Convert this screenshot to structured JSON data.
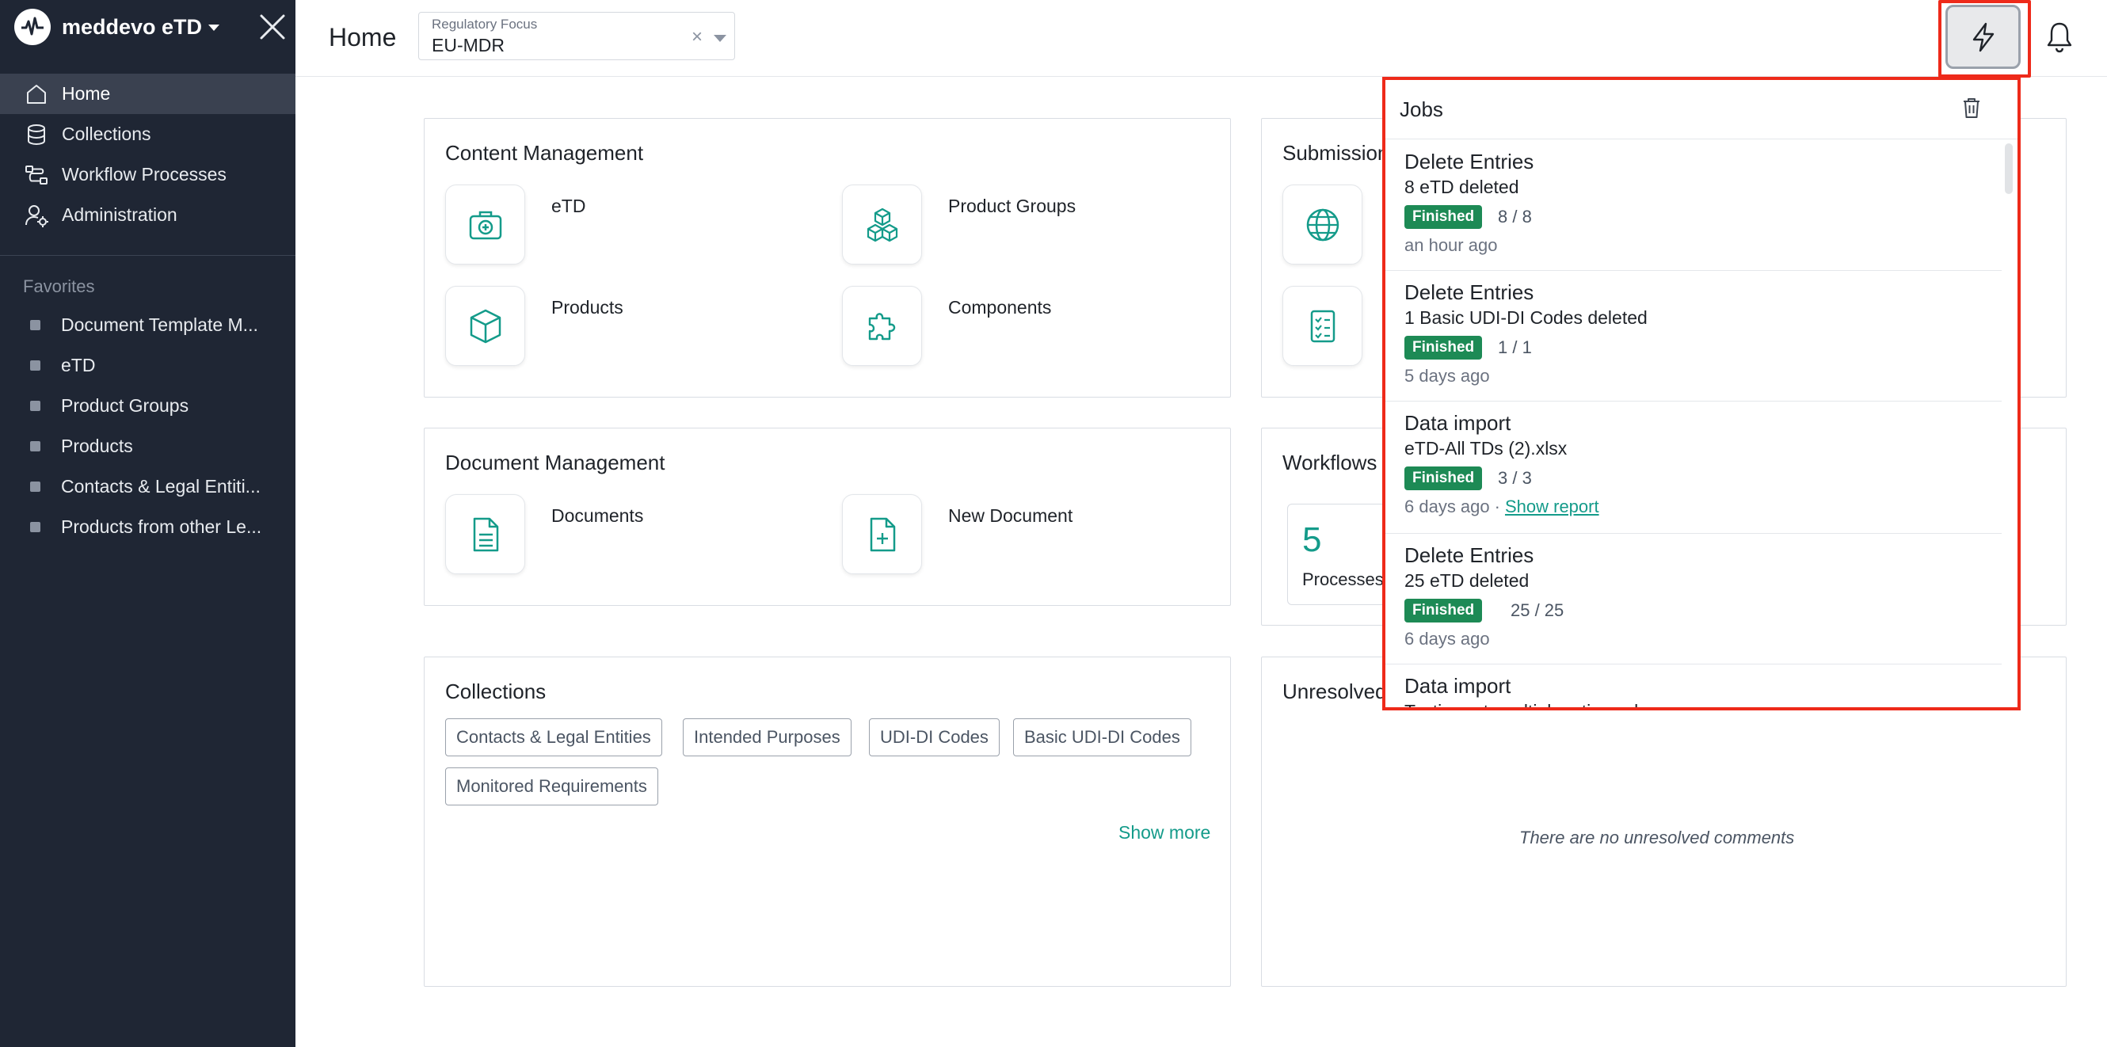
{
  "app": {
    "name": "meddevo eTD"
  },
  "sidebar": {
    "nav": [
      {
        "label": "Home",
        "icon": "home-icon",
        "active": true
      },
      {
        "label": "Collections",
        "icon": "database-icon"
      },
      {
        "label": "Workflow Processes",
        "icon": "workflow-icon"
      },
      {
        "label": "Administration",
        "icon": "user-gear-icon"
      }
    ],
    "favorites_heading": "Favorites",
    "favorites": [
      "Document Template M...",
      "eTD",
      "Product Groups",
      "Products",
      "Contacts & Legal Entiti...",
      "Products from other Le..."
    ]
  },
  "topbar": {
    "title": "Home",
    "regulatory_focus": {
      "label": "Regulatory Focus",
      "value": "EU-MDR",
      "clear": "×"
    }
  },
  "content_management": {
    "title": "Content Management",
    "tiles": [
      {
        "label": "eTD",
        "icon": "medical-bag-icon"
      },
      {
        "label": "Product Groups",
        "icon": "cubes-icon"
      },
      {
        "label": "Products",
        "icon": "cube-icon"
      },
      {
        "label": "Components",
        "icon": "puzzle-icon"
      }
    ]
  },
  "submissions": {
    "title": "Submission",
    "tiles": [
      {
        "icon": "globe-icon"
      },
      {
        "icon": "checklist-icon"
      }
    ]
  },
  "document_management": {
    "title": "Document Management",
    "tiles": [
      {
        "label": "Documents",
        "icon": "document-icon"
      },
      {
        "label": "New Document",
        "icon": "document-add-icon"
      }
    ]
  },
  "workflows": {
    "title": "Workflows",
    "stat": {
      "value": "5",
      "label": "Processes"
    }
  },
  "collections": {
    "title": "Collections",
    "chips": [
      "Contacts & Legal Entities",
      "Intended Purposes",
      "UDI-DI Codes",
      "Basic UDI-DI Codes",
      "Monitored Requirements"
    ],
    "show_more": "Show more"
  },
  "unresolved": {
    "title": "Unresolved",
    "empty": "There are no unresolved comments"
  },
  "jobs": {
    "title": "Jobs",
    "items": [
      {
        "name": "Delete Entries",
        "desc": "8 eTD deleted",
        "status": "Finished",
        "count": "8 / 8",
        "time": "an hour ago",
        "link": ""
      },
      {
        "name": "Delete Entries",
        "desc": "1 Basic UDI-DI Codes deleted",
        "status": "Finished",
        "count": "1 / 1",
        "time": "5 days ago",
        "link": ""
      },
      {
        "name": "Data import",
        "desc": "eTD-All TDs (2).xlsx",
        "status": "Finished",
        "count": "3 / 3",
        "time": "6 days ago",
        "sep": "·",
        "link": "Show report"
      },
      {
        "name": "Delete Entries",
        "desc": "25 eTD deleted",
        "status": "Finished",
        "count": "25 / 25",
        "time": "6 days ago",
        "link": ""
      },
      {
        "name": "Data import",
        "desc": "Testimport_multipleoptions.xlsx",
        "status": "",
        "count": "",
        "time": "",
        "link": ""
      }
    ]
  },
  "colors": {
    "accent": "#149b8a",
    "sidebar": "#1f2634",
    "badge": "#1d8a55",
    "highlight": "#ee2a1a"
  }
}
